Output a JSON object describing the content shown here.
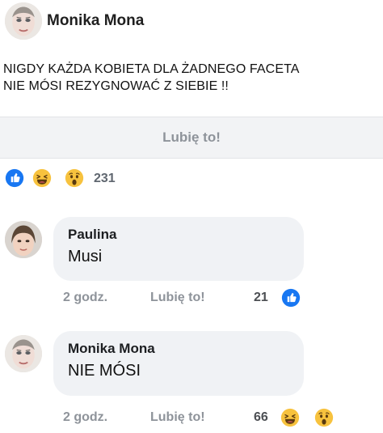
{
  "post": {
    "author": "Monika Mona",
    "text_line1": "NIGDY KAŻDA KOBIETA DLA ŻADNEGO FACETA",
    "text_line2": "NIE MÓSI  REZYGNOWAĆ Z SIEBIE !!"
  },
  "like_bar": {
    "label": "Lubię to!"
  },
  "reactions": {
    "icons": [
      "like-icon",
      "laugh-icon",
      "wow-icon"
    ],
    "count": "231"
  },
  "comments": [
    {
      "author": "Paulina",
      "text": "Musi",
      "time": "2 godz.",
      "like_label": "Lubię to!",
      "reaction_count": "21",
      "reaction_icons": [
        "like-icon"
      ]
    },
    {
      "author": "Monika Mona",
      "text": "NIE MÓSI",
      "time": "2 godz.",
      "like_label": "Lubię to!",
      "reaction_count": "66",
      "reaction_icons": [
        "laugh-icon",
        "wow-icon"
      ]
    }
  ],
  "colors": {
    "like_blue": "#1877f2",
    "emoji_yellow": "#f7c23e",
    "bubble_bg": "#f0f2f5"
  }
}
